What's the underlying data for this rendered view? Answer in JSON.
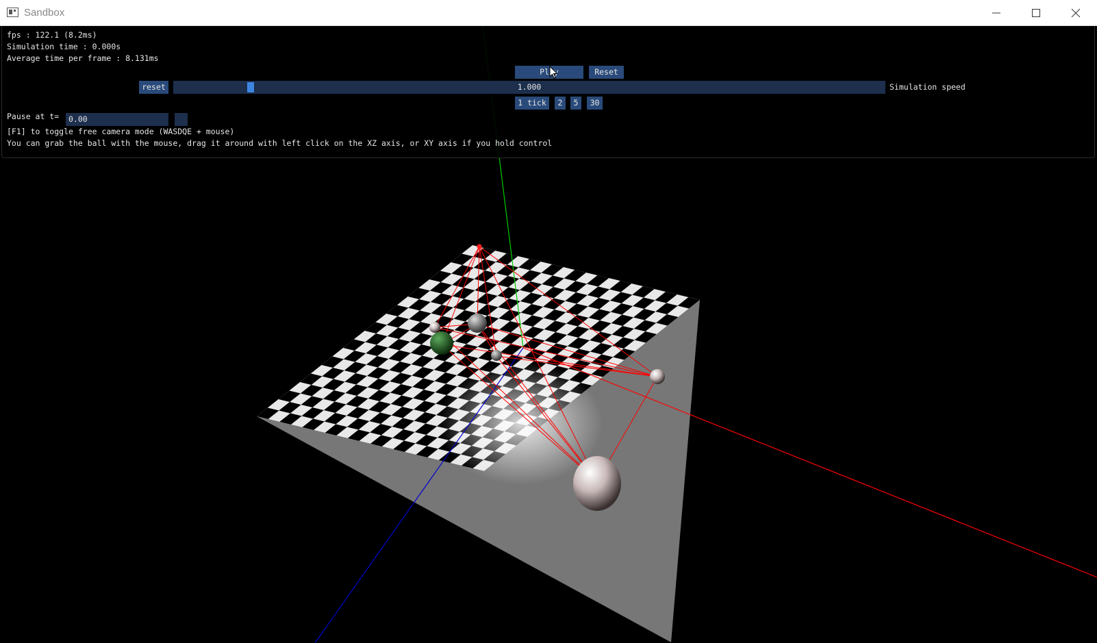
{
  "window": {
    "title": "Sandbox",
    "icon": "app-window-icon"
  },
  "panel": {
    "fps": "fps : 122.1 (8.2ms)",
    "sim_time": "Simulation time : 0.000s",
    "avg_frame": "Average time per frame : 8.131ms",
    "play_label": "Play",
    "reset_label": "Reset",
    "speed_reset_label": "reset",
    "speed_value": "1.000",
    "speed_fraction": 0.105,
    "speed_label": "Simulation speed",
    "step_buttons": [
      "1 tick",
      "2",
      "5",
      "30"
    ],
    "pause_label": "Pause at t=",
    "pause_value": "0.00",
    "help_camera": "[F1] to toggle free camera mode (WASDQE + mouse)",
    "help_grab": "You can grab the ball with the mouse, drag it around with left click on the XZ axis, or XY axis if you hold control"
  },
  "colors": {
    "button": "#294a7a",
    "frame": "#1d2f4d",
    "slider_grab": "#3d85e0",
    "axis_x": "#ff0000",
    "axis_y": "#00cc00",
    "axis_z": "#0000ff"
  }
}
